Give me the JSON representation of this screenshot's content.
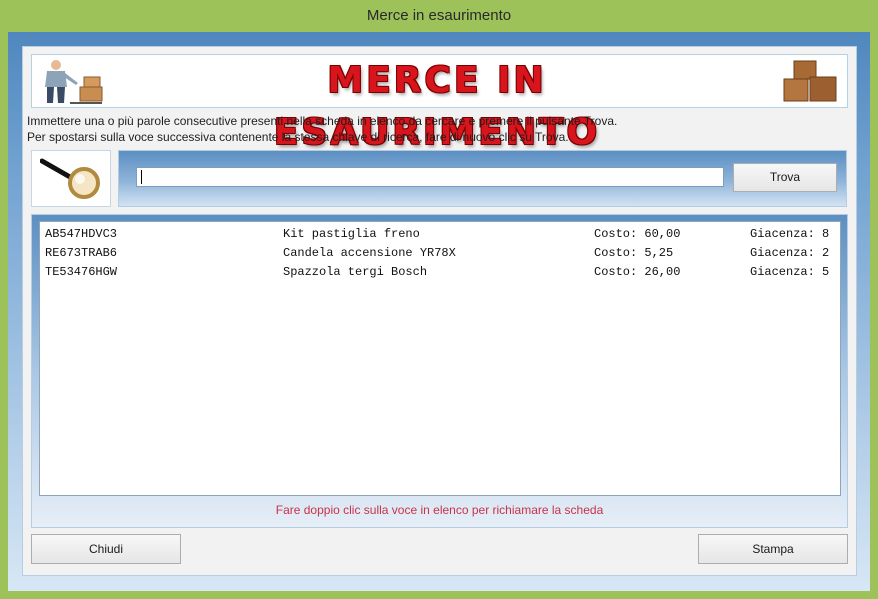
{
  "window": {
    "title": "Merce in esaurimento"
  },
  "banner": {
    "title": "MERCE IN ESAURIMENTO"
  },
  "instructions": {
    "line1": "Immettere una o più parole consecutive presenti nella scheda in elenco da cercare e premere il pulsante Trova.",
    "line2": "Per spostarsi sulla voce successiva contenente la stessa chiave di ricerca, fare di nuovo clic su Trova."
  },
  "search": {
    "value": "",
    "button_label": "Trova"
  },
  "list": {
    "rows": [
      {
        "code": "AB547HDVC3",
        "description": "Kit pastiglia freno",
        "cost": "Costo: 60,00",
        "stock": "Giacenza: 8"
      },
      {
        "code": "RE673TRAB6",
        "description": "Candela accensione YR78X",
        "cost": "Costo: 5,25",
        "stock": "Giacenza: 2"
      },
      {
        "code": "TE53476HGW",
        "description": "Spazzola tergi Bosch",
        "cost": "Costo: 26,00",
        "stock": "Giacenza: 5"
      }
    ],
    "hint": "Fare doppio clic sulla voce in elenco per richiamare la scheda"
  },
  "footer": {
    "close_label": "Chiudi",
    "print_label": "Stampa"
  },
  "icons": {
    "banner_left": "delivery-man-icon",
    "banner_right": "boxes-icon",
    "search": "magnifier-icon"
  },
  "colors": {
    "title_red": "#d8141c",
    "hint_red": "#c8324a",
    "frame_green": "#9dc25a"
  }
}
